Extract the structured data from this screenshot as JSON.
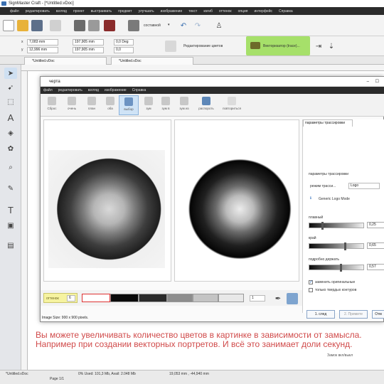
{
  "window": {
    "title": "SignMaster Craft - [*Untitled.vDoc]"
  },
  "menu": [
    "файл",
    "редактировать",
    "взгляд",
    "проект",
    "выстраивать",
    "предмет",
    "улучшать",
    "изображение",
    "текст",
    "изгиб",
    "оттенок",
    "опция",
    "интерфейс",
    "Справка"
  ],
  "toolbar": {
    "mode_label": "составной",
    "x_value": "7,083 mm",
    "y_value": "12,996 mm",
    "w_value": "197,905 mm",
    "h_value": "197,905 mm",
    "angle1": "0,0 Deg",
    "angle2": "0,0",
    "edit_colors_label": "Редактирование цветов",
    "vectorizer_label": "Векторизатор (trace)...",
    "highlight_color": "#a6e06a"
  },
  "tabs": [
    "*Untitled.vDoc",
    "*Untitled.vDoc"
  ],
  "dialog": {
    "title": "черта",
    "menu": [
      "файл",
      "редактировать",
      "взгляд",
      "изображение",
      "Справка"
    ],
    "tools": [
      {
        "label": "Сброс",
        "icon": "reset-icon"
      },
      {
        "label": "очень",
        "icon": "very-icon"
      },
      {
        "label": "план",
        "icon": "plan-icon"
      },
      {
        "label": "оба",
        "icon": "both-icon"
      },
      {
        "label": "выбор",
        "icon": "select-icon"
      },
      {
        "label": "зум",
        "icon": "zoom-icon"
      },
      {
        "label": "зум в",
        "icon": "zoom-in-icon"
      },
      {
        "label": "зум из",
        "icon": "zoom-out-icon"
      },
      {
        "label": "распороть",
        "icon": "undo-icon"
      },
      {
        "label": "повториться",
        "icon": "redo-icon"
      }
    ],
    "settings": {
      "tab_label": "параметры трассировки",
      "section_label": "параметры трассировки",
      "mode_label": "режим трасси...",
      "mode_value": "Logo",
      "mode_desc": "Generic Logo Mode",
      "smooth_label": "плавный",
      "smooth_value": "0,25",
      "edge_label": "край",
      "edge_value": "0,65",
      "detail_label": "подробно держать",
      "detail_value": "0,57",
      "replace_label": "заменить оригинальные",
      "solid_label": "только твердых контуров"
    },
    "shades_label": "оттенок",
    "shades_value": "6",
    "zoom_value": "1",
    "image_size": "Image Size: 900 x 900 pixels.",
    "next_button": "1. след",
    "apply_button": "2. Примите",
    "cancel_button": "Отм"
  },
  "caption": "Вы можете увеличивать количество цветов в картинке в зависимости от замысла. Например при создании векторных портретов. И всё это занимает доли секунд.",
  "statusbar": {
    "tab_label": "*Untitled.vDoc",
    "page_label": "Page 1/1",
    "memory": "0%   Used: 101,3 Mb, Avail: 2.048 Mb",
    "coords": "19,053 mm , -44,940 mm",
    "lock_label": "Замок вкл/выкл"
  }
}
